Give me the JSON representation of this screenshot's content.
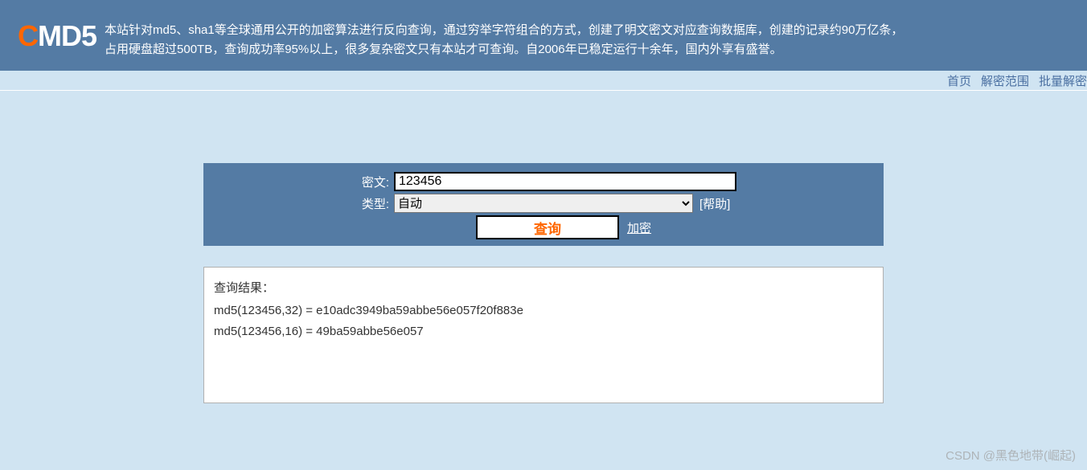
{
  "header": {
    "logo_c": "C",
    "logo_rest": "MD5",
    "description": "本站针对md5、sha1等全球通用公开的加密算法进行反向查询，通过穷举字符组合的方式，创建了明文密文对应查询数据库，创建的记录约90万亿条，占用硬盘超过500TB，查询成功率95%以上，很多复杂密文只有本站才可查询。自2006年已稳定运行十余年，国内外享有盛誉。"
  },
  "nav": {
    "items": [
      "首页",
      "解密范围",
      "批量解密"
    ]
  },
  "form": {
    "cipher_label": "密文:",
    "cipher_value": "123456",
    "type_label": "类型:",
    "type_value": "自动",
    "help_link": "[帮助]",
    "query_btn": "查询",
    "encrypt_link": "加密"
  },
  "result": {
    "title": "查询结果：",
    "lines": [
      "md5(123456,32) = e10adc3949ba59abbe56e057f20f883e",
      "md5(123456,16) = 49ba59abbe56e057"
    ]
  },
  "watermark": "CSDN @黑色地带(崛起)"
}
